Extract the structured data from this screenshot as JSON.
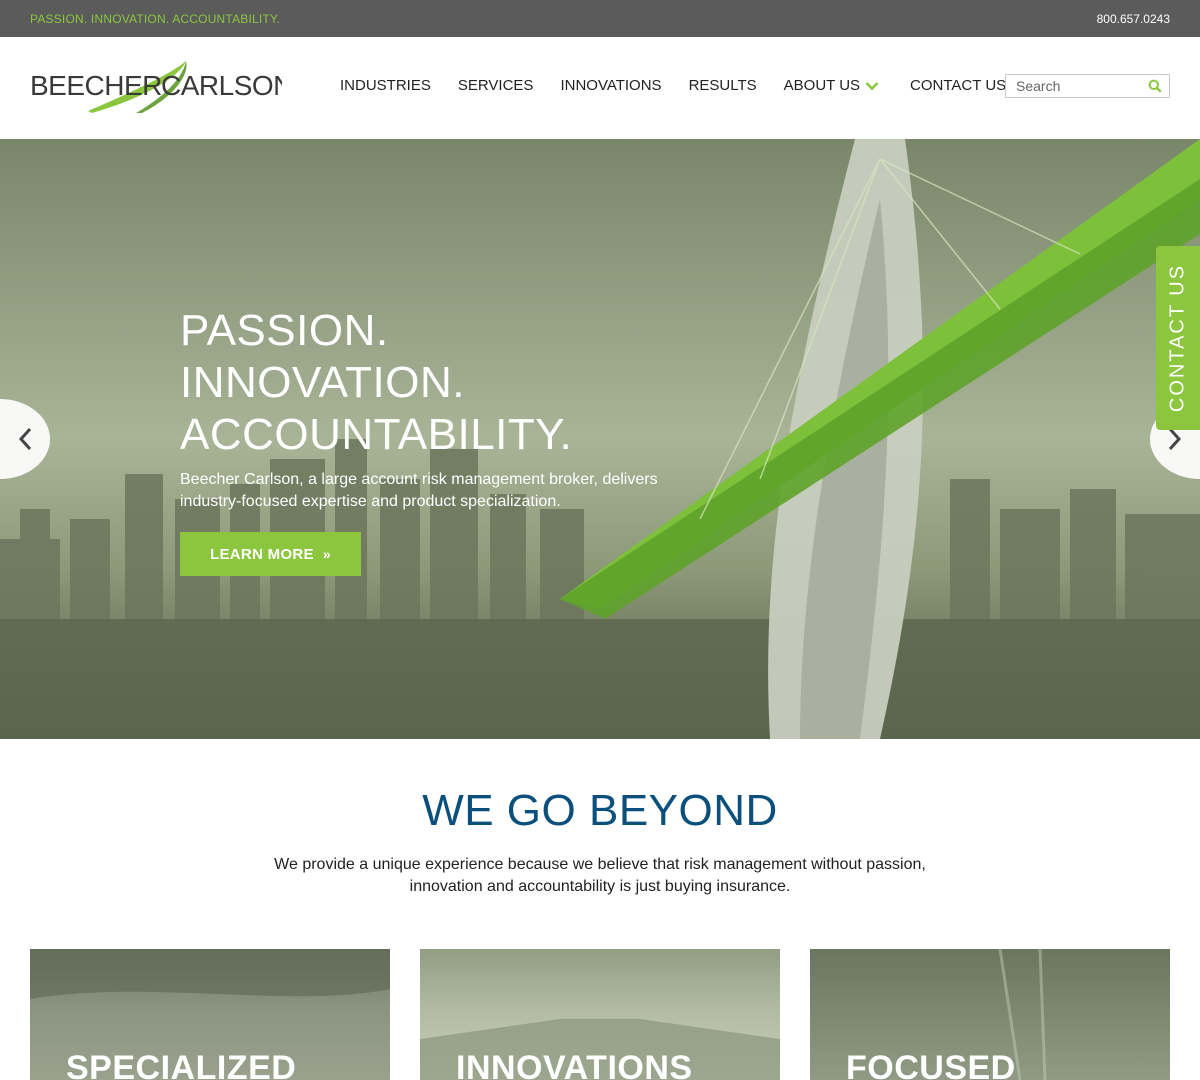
{
  "topbar": {
    "tagline": "PASSION. INNOVATION. ACCOUNTABILITY.",
    "phone": "800.657.0243"
  },
  "logo": {
    "left_text": "BEECHER",
    "right_text": "CARLSON"
  },
  "nav": {
    "items": [
      {
        "label": "INDUSTRIES"
      },
      {
        "label": "SERVICES"
      },
      {
        "label": "INNOVATIONS"
      },
      {
        "label": "RESULTS"
      },
      {
        "label": "ABOUT US"
      },
      {
        "label": "CONTACT US"
      }
    ]
  },
  "search": {
    "placeholder": "Search"
  },
  "hero": {
    "title_lines": [
      "PASSION.",
      "INNOVATION.",
      "ACCOUNTABILITY."
    ],
    "subtitle": "Beecher Carlson, a large account risk management broker, delivers industry-focused expertise and product specialization.",
    "button_label": "LEARN MORE",
    "side_tab": "CONTACT US"
  },
  "beyond": {
    "title": "WE GO BEYOND",
    "text": "We provide a unique experience because we believe that risk management without passion, innovation and accountability is just buying insurance."
  },
  "cards": [
    {
      "label": "SPECIALIZED"
    },
    {
      "label": "INNOVATIONS"
    },
    {
      "label": "FOCUSED"
    }
  ],
  "colors": {
    "accent_green": "#8cc63f",
    "title_blue": "#0b4f7c",
    "topbar_gray": "#5b5b5b"
  }
}
